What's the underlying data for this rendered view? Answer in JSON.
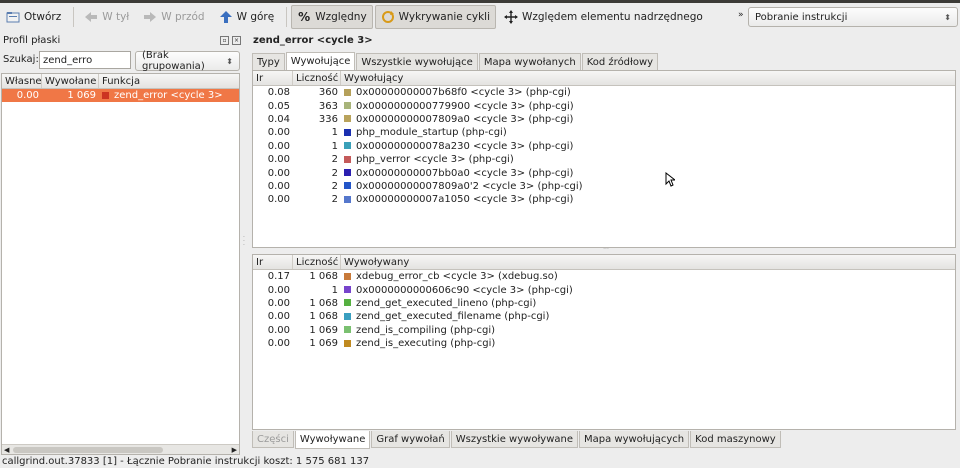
{
  "toolbar": {
    "open": "Otwórz",
    "back": "W tył",
    "forward": "W przód",
    "up": "W górę",
    "relative": "Względny",
    "cycles": "Wykrywanie cykli",
    "relative_parent": "Względem elementu nadrzędnego",
    "event_type": "Pobranie instrukcji"
  },
  "left": {
    "title": "Profil płaski",
    "search_label": "Szukaj:",
    "search_value": "zend_erro",
    "grouping": "(Brak grupowania)",
    "headers": [
      "Własne",
      "Wywołane",
      "Funkcja"
    ],
    "rows": [
      {
        "self": "0.00",
        "called": "1 069",
        "func": "zend_error <cycle 3>",
        "color": "#cc3322"
      }
    ]
  },
  "right": {
    "title": "zend_error <cycle 3>",
    "top_tabs": [
      "Typy",
      "Wywołujące",
      "Wszystkie wywołujące",
      "Mapa wywołanych",
      "Kod źródłowy"
    ],
    "callers_headers": [
      "Ir",
      "Liczność",
      "Wywołujący"
    ],
    "callers": [
      {
        "ir": "0.08",
        "count": "360",
        "name": "0x00000000007b68f0 <cycle 3> (php-cgi)",
        "color": "#b5a05a"
      },
      {
        "ir": "0.05",
        "count": "363",
        "name": "0x0000000000779900 <cycle 3> (php-cgi)",
        "color": "#a8b47a"
      },
      {
        "ir": "0.04",
        "count": "336",
        "name": "0x00000000007809a0 <cycle 3> (php-cgi)",
        "color": "#b9a35c"
      },
      {
        "ir": "0.00",
        "count": "1",
        "name": "php_module_startup (php-cgi)",
        "color": "#1a2fb0"
      },
      {
        "ir": "0.00",
        "count": "1",
        "name": "0x000000000078a230 <cycle 3> (php-cgi)",
        "color": "#3aa0b8"
      },
      {
        "ir": "0.00",
        "count": "2",
        "name": "php_verror <cycle 3> (php-cgi)",
        "color": "#c45a5a"
      },
      {
        "ir": "0.00",
        "count": "2",
        "name": "0x00000000007bb0a0 <cycle 3> (php-cgi)",
        "color": "#2a1fb0"
      },
      {
        "ir": "0.00",
        "count": "2",
        "name": "0x00000000007809a0'2 <cycle 3> (php-cgi)",
        "color": "#2255c8"
      },
      {
        "ir": "0.00",
        "count": "2",
        "name": "0x00000000007a1050 <cycle 3> (php-cgi)",
        "color": "#5577cc"
      }
    ],
    "callees_headers": [
      "Ir",
      "Liczność",
      "Wywoływany"
    ],
    "callees": [
      {
        "ir": "0.17",
        "count": "1 068",
        "name": "xdebug_error_cb <cycle 3> (xdebug.so)",
        "color": "#c87a3a"
      },
      {
        "ir": "0.00",
        "count": "1",
        "name": "0x0000000000606c90 <cycle 3> (php-cgi)",
        "color": "#7744cc"
      },
      {
        "ir": "0.00",
        "count": "1 068",
        "name": "zend_get_executed_lineno (php-cgi)",
        "color": "#55b040"
      },
      {
        "ir": "0.00",
        "count": "1 068",
        "name": "zend_get_executed_filename (php-cgi)",
        "color": "#3a9fc0"
      },
      {
        "ir": "0.00",
        "count": "1 069",
        "name": "zend_is_compiling (php-cgi)",
        "color": "#7ac070"
      },
      {
        "ir": "0.00",
        "count": "1 069",
        "name": "zend_is_executing (php-cgi)",
        "color": "#c08a20"
      }
    ],
    "bottom_tabs": [
      "Części",
      "Wywoływane",
      "Graf wywołań",
      "Wszystkie wywoływane",
      "Mapa wywołujących",
      "Kod maszynowy"
    ]
  },
  "status": "callgrind.out.37833 [1] - Łącznie Pobranie instrukcji koszt: 1 575 681 137"
}
